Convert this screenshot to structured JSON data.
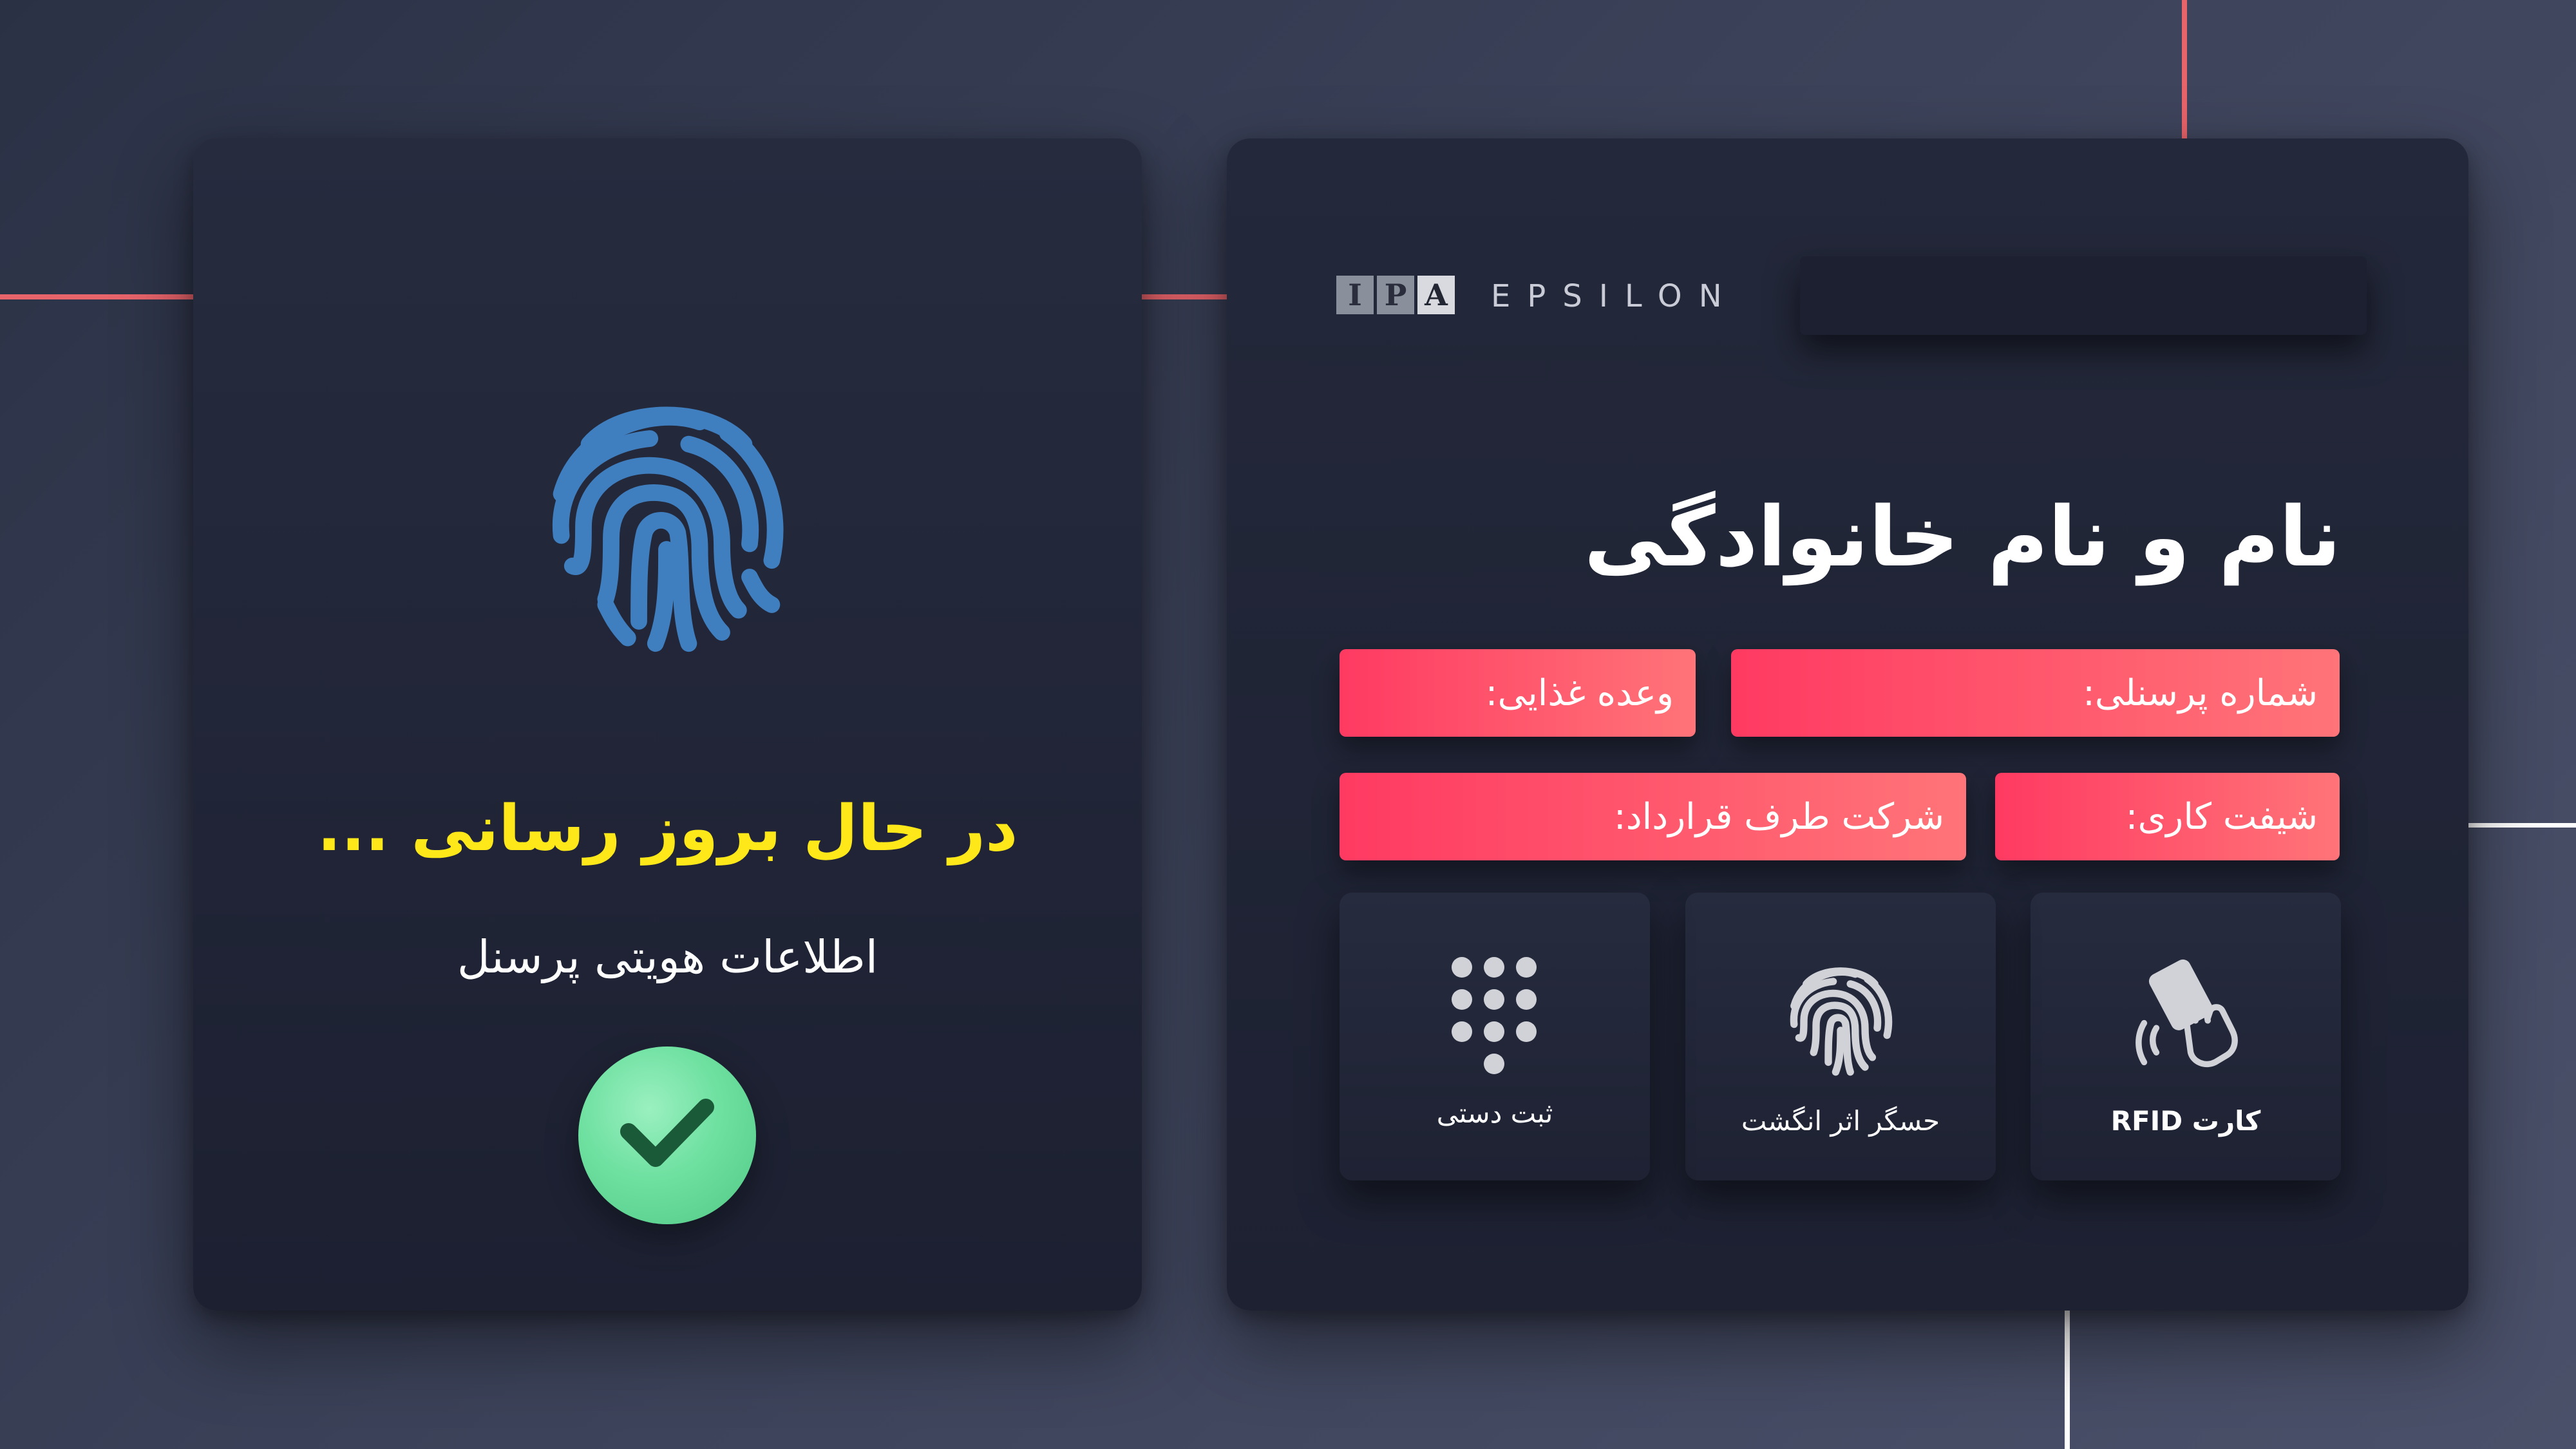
{
  "brand": {
    "logo_letters": [
      "I",
      "P",
      "A"
    ],
    "name": "EPSILON"
  },
  "status": {
    "title": "در حال بروز رسانی ...",
    "subtitle": "اطلاعات هویتی پرسنل",
    "check_color": "#5fd894"
  },
  "employee": {
    "name_title": "نام و نام خانوادگی",
    "fields": {
      "personnel_number": "شماره پرسنلی:",
      "meal": "وعده غذایی:",
      "shift": "شیفت کاری:",
      "company": "شرکت طرف قرارداد:"
    }
  },
  "methods": [
    {
      "id": "rfid",
      "label": "کارت RFID",
      "icon": "rfid-card-icon"
    },
    {
      "id": "fingerprint",
      "label": "حسگر اثر انگشت",
      "icon": "fingerprint-icon"
    },
    {
      "id": "manual",
      "label": "ثبت دستی",
      "icon": "keypad-icon"
    }
  ],
  "colors": {
    "accent_red": "#ff3a62",
    "accent_pink": "#ff7478",
    "status_yellow": "#ffe81a",
    "fingerprint_blue": "#3f7fc0",
    "line_red": "#e8646b"
  }
}
